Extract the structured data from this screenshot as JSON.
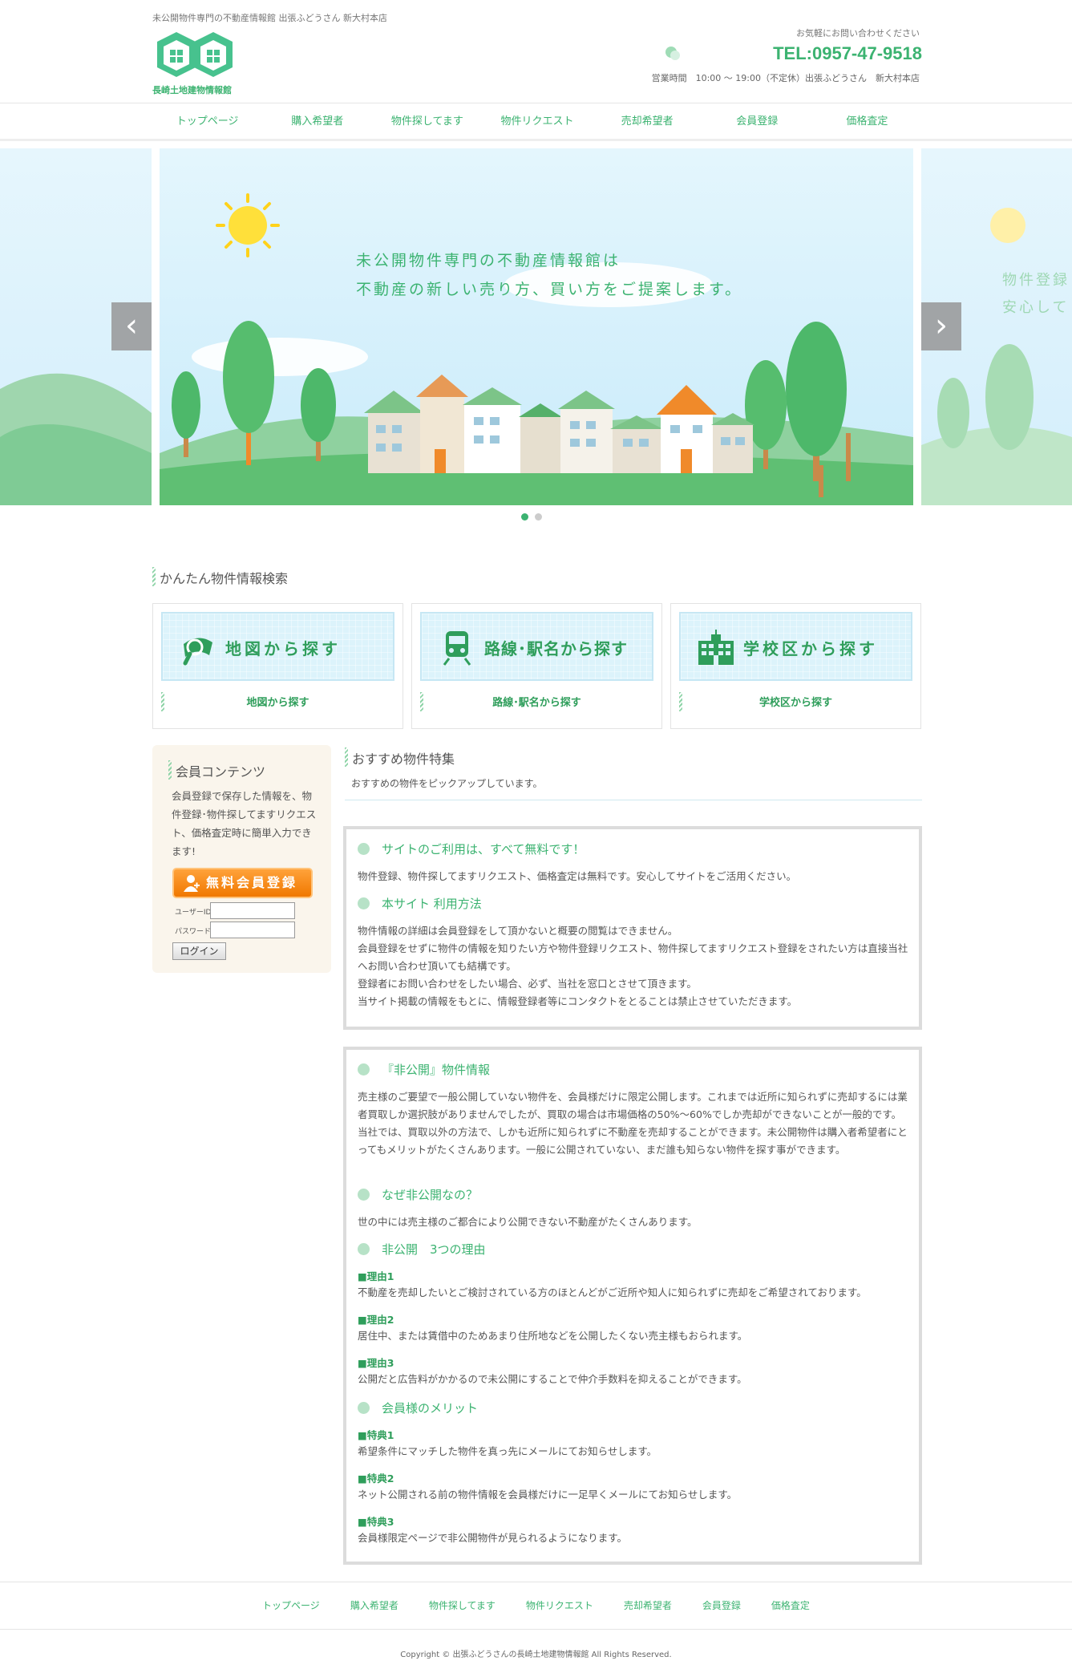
{
  "header": {
    "tagline": "未公開物件専門の不動産情報館 出張ふどうさん 新大村本店",
    "logo_text": "長崎土地建物情報館",
    "contact_label": "お気軽にお問い合わせください",
    "tel": "TEL:0957-47-9518",
    "hours": "営業時間　10:00 ～ 19:00（不定休）出張ふどうさん　新大村本店"
  },
  "nav": {
    "items": [
      "トップページ",
      "購入希望者",
      "物件探してます",
      "物件リクエスト",
      "売却希望者",
      "会員登録",
      "価格査定"
    ]
  },
  "slider": {
    "caption_line1": "未公開物件専門の不動産情報館は",
    "caption_line2": "不動産の新しい売り方、買い方をご提案します。",
    "side_line1": "物件登録",
    "side_line2": "安心して",
    "prev_arrow": "‹",
    "next_arrow": "›",
    "active_slide": 1,
    "slide_count": 2
  },
  "search": {
    "heading": "かんたん物件情報検索",
    "boxes": [
      {
        "button": "地図から探す",
        "link": "地図から探す"
      },
      {
        "button": "路線･駅名から探す",
        "link": "路線･駅名から探す"
      },
      {
        "button": "学校区から探す",
        "link": "学校区から探す"
      }
    ]
  },
  "member": {
    "heading": "会員コンテンツ",
    "description": "会員登録で保存した情報を、物件登録･物件探してますリクエスト、価格査定時に簡単入力できます!",
    "register_button": "無料会員登録",
    "user_id_label": "ユーザーID:",
    "password_label": "パスワード:",
    "login_button": "ログイン"
  },
  "recommend": {
    "heading": "おすすめ物件特集",
    "subtitle": "おすすめの物件をピックアップしています。"
  },
  "info1": {
    "h1": "サイトのご利用は、すべて無料です！",
    "p1": "物件登録、物件探してますリクエスト、価格査定は無料です。安心してサイトをご活用ください。",
    "h2": "本サイト 利用方法",
    "p2a": "物件情報の詳細は会員登録をして頂かないと概要の閲覧はできません。",
    "p2b": "会員登録をせずに物件の情報を知りたい方や物件登録リクエスト、物件探してますリクエスト登録をされたい方は直接当社へお問い合わせ頂いても結構です。",
    "p2c": "登録者にお問い合わせをしたい場合、必ず、当社を窓口とさせて頂きます。",
    "p2d": "当サイト掲載の情報をもとに、情報登録者等にコンタクトをとることは禁止させていただきます。"
  },
  "info2": {
    "h1": "『非公開』物件情報",
    "p1": "売主様のご要望で一般公開していない物件を、会員様だけに限定公開します。これまでは近所に知られずに売却するには業者買取しか選択肢がありませんでしたが、買取の場合は市場価格の50%～60%でしか売却ができないことが一般的です。当社では、買取以外の方法で、しかも近所に知られずに不動産を売却することができます。未公開物件は購入者希望者にとってもメリットがたくさんあります。一般に公開されていない、まだ誰も知らない物件を探す事ができます。",
    "h2": "なぜ非公開なの？",
    "p2": "世の中には売主様のご都合により公開できない不動産がたくさんあります。",
    "h3": "非公開　3つの理由",
    "r1_title": "■理由1",
    "r1": "不動産を売却したいとご検討されている方のほとんどがご近所や知人に知られずに売却をご希望されております。",
    "r2_title": "■理由2",
    "r2": "居住中、または賃借中のためあまり住所地などを公開したくない売主様もおられます。",
    "r3_title": "■理由3",
    "r3": "公開だと広告料がかかるので未公開にすることで仲介手数料を抑えることができます。",
    "h4": "会員様のメリット",
    "b1_title": "■特典1",
    "b1": "希望条件にマッチした物件を真っ先にメールにてお知らせします。",
    "b2_title": "■特典2",
    "b2": "ネット公開される前の物件情報を会員様だけに一足早くメールにてお知らせします。",
    "b3_title": "■特典3",
    "b3": "会員様限定ページで非公開物件が見られるようになります。"
  },
  "footer": {
    "items": [
      "トップページ",
      "購入希望者",
      "物件探してます",
      "物件リクエスト",
      "売却希望者",
      "会員登録",
      "価格査定"
    ],
    "copyright": "Copyright © 出張ふどうさんの長崎土地建物情報館 All Rights Reserved."
  },
  "colors": {
    "brand_green": "#3cb371",
    "accent_orange": "#f07800",
    "sky": "#d8f1fc"
  }
}
